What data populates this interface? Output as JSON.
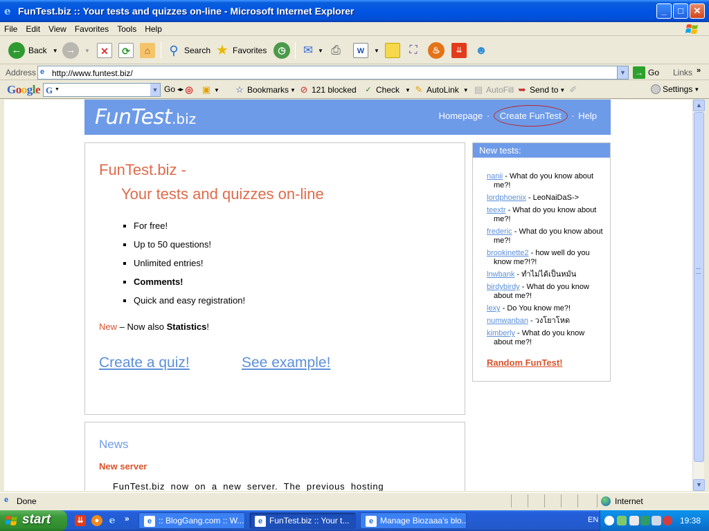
{
  "window": {
    "title": "FunTest.biz :: Your tests and quizzes on-line - Microsoft Internet Explorer",
    "minimize": "_",
    "maximize": "□",
    "close": "✕"
  },
  "menu": [
    "File",
    "Edit",
    "View",
    "Favorites",
    "Tools",
    "Help"
  ],
  "toolbar": {
    "back": "Back",
    "search": "Search",
    "favorites": "Favorites"
  },
  "address": {
    "label": "Address",
    "url": "http://www.funtest.biz/",
    "go": "Go",
    "links": "Links"
  },
  "google_bar": {
    "logo": "Google",
    "go": "Go",
    "bookmarks": "Bookmarks",
    "blocked": "121 blocked",
    "check": "Check",
    "autolink": "AutoLink",
    "autofill": "AutoFill",
    "sendto": "Send to",
    "settings": "Settings"
  },
  "site": {
    "logo_main": "FunTest",
    "logo_suffix": ".biz",
    "nav": [
      "Homepage",
      "Create FunTest",
      "Help"
    ],
    "nav_sep": "·",
    "headline1": "FunTest.biz -",
    "headline2": "Your tests and quizzes on-line",
    "features": [
      "For free!",
      "Up to 50 questions!",
      "Unlimited entries!",
      "Comments!",
      "Quick and easy registration!"
    ],
    "new_label": "New",
    "new_text": " – Now also ",
    "new_strong": "Statistics",
    "new_end": "!",
    "cta_create": "Create a quiz!",
    "cta_example": "See example!",
    "sidebar": {
      "header": "New tests:",
      "items": [
        {
          "user": "nanii",
          "title": " - What do you know about me?!"
        },
        {
          "user": "lordphoenix",
          "title": " - LeoNaiDaS->"
        },
        {
          "user": "teextr",
          "title": " - What do you know about me?!"
        },
        {
          "user": "frederic",
          "title": " - What do you know about me?!"
        },
        {
          "user": "brookinette2",
          "title": " - how well do you know me?!?!"
        },
        {
          "user": "lnwbank",
          "title": " - ทำไม่ได้เป็นหมัน"
        },
        {
          "user": "birdybirdy",
          "title": " - What do you know about me?!"
        },
        {
          "user": "lexy",
          "title": " - Do You know me?!"
        },
        {
          "user": "numwanban",
          "title": " - วงโยาโหด"
        },
        {
          "user": "kimberly",
          "title": " - What do you know about me?!"
        }
      ],
      "random": "Random FunTest!"
    },
    "news": {
      "heading": "News",
      "subheading": "New server",
      "text": "FunTest.biz now on a new server. The previous hosting"
    }
  },
  "status": {
    "text": "Done",
    "zone": "Internet"
  },
  "taskbar": {
    "start": "start",
    "tasks": [
      {
        "label": ":: BlogGang.com :: W...",
        "active": false
      },
      {
        "label": "FunTest.biz :: Your t...",
        "active": true
      },
      {
        "label": "Manage Biozaaa's blo...",
        "active": false
      }
    ],
    "lang": "EN",
    "clock": "19:38"
  },
  "colors": {
    "site_blue": "#6e9be8",
    "accent_orange": "#e06a4a",
    "link_blue": "#5b8fd9"
  }
}
